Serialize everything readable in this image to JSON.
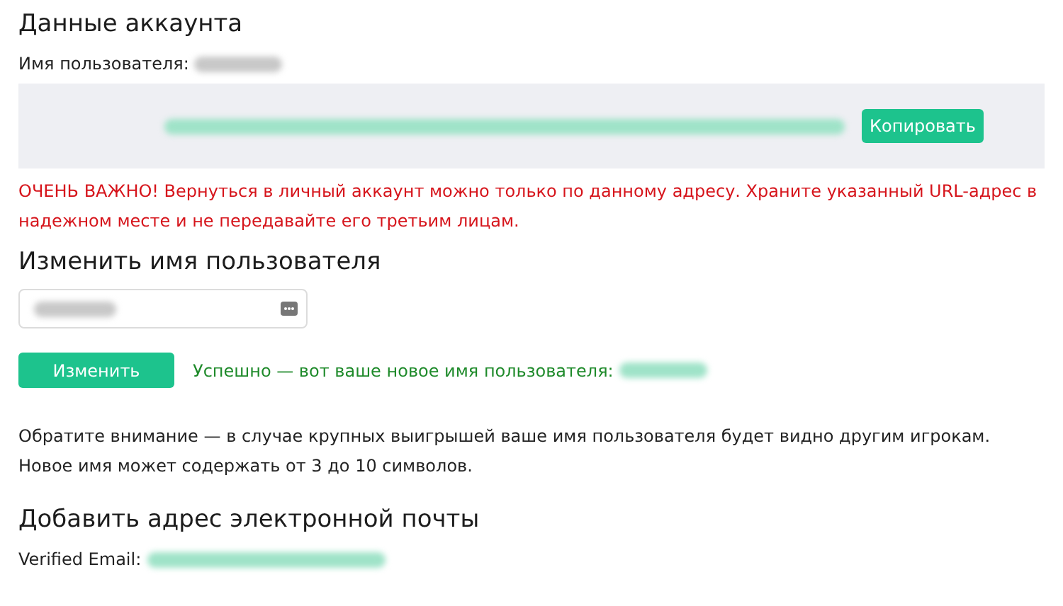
{
  "account": {
    "title": "Данные аккаунта",
    "username_label": "Имя пользователя:",
    "copy_button": "Копировать",
    "warning": "ОЧЕНЬ ВАЖНО! Вернуться в личный аккаунт можно только по данному адресу. Храните указанный URL-адрес в надежном месте и не передавайте его третьим лицам."
  },
  "change_name": {
    "title": "Изменить имя пользователя",
    "button": "Изменить",
    "success": "Успешно — вот ваше новое имя пользователя:",
    "note": "Обратите внимание — в случае крупных выигрышей ваше имя пользователя будет видно другим игрокам. Новое имя может содержать от 3 до 10 символов."
  },
  "email": {
    "title": "Добавить адрес электронной почты",
    "label": "Verified Email:"
  }
}
